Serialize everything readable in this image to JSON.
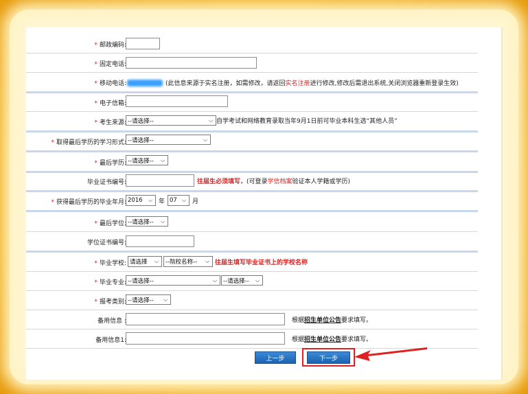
{
  "rows": {
    "postal": {
      "label": "邮政编码:"
    },
    "phone": {
      "label": "固定电话:"
    },
    "mobile": {
      "label": "移动电话:",
      "note_a": "(此信息来源于实名注册，如需修改，请返回 ",
      "link": "实名注册",
      "note_b": " 进行修改,修改后需退出系统,关闭浏览器重新登录生效)"
    },
    "email": {
      "label": "电子信箱:"
    },
    "source": {
      "label": "考生来源:",
      "select": "--请选择--",
      "note": "自学考试和网络教育录取当年9月1日前可毕业本科生选“其他人员”"
    },
    "study_form": {
      "label": "取得最后学历的学习形式:",
      "select": "--请选择--"
    },
    "education": {
      "label": "最后学历:",
      "select": "--请选择--"
    },
    "cert_no": {
      "label": "毕业证书编号:",
      "red_note": "往届生必须填写",
      "note_a": "，(可登录",
      "link": "学信档案",
      "note_b": "验证本人学籍或学历)"
    },
    "grad_date": {
      "label": "获得最后学历的毕业年月:",
      "year": "2016",
      "year_unit": "年",
      "month": "07",
      "month_unit": "月"
    },
    "degree": {
      "label": "最后学位:",
      "select": "--请选择--"
    },
    "degree_no": {
      "label": "学位证书编号:"
    },
    "school": {
      "label": "毕业学校:",
      "select1": "请选择",
      "select2": "--院校名称--",
      "red_note": "往届生填写毕业证书上的学校名称"
    },
    "major": {
      "label": "毕业专业:",
      "select1": "--请选择--",
      "select2": "--请选择--"
    },
    "exam_type": {
      "label": "报考类别:",
      "select": "--请选择--"
    },
    "backup1": {
      "label": "备用信息 :",
      "note_a": "根据",
      "link": "招生单位公告",
      "note_b": "要求填写。"
    },
    "backup2": {
      "label": "备用信息1:",
      "note_a": "根据",
      "link": "招生单位公告",
      "note_b": "要求填写。"
    }
  },
  "required_mark": "*",
  "buttons": {
    "prev": "上一步",
    "next": "下一步"
  },
  "colors": {
    "accent_red": "#e02020",
    "button_blue": "#2a74c6",
    "frame_gold": "#f7b623"
  }
}
